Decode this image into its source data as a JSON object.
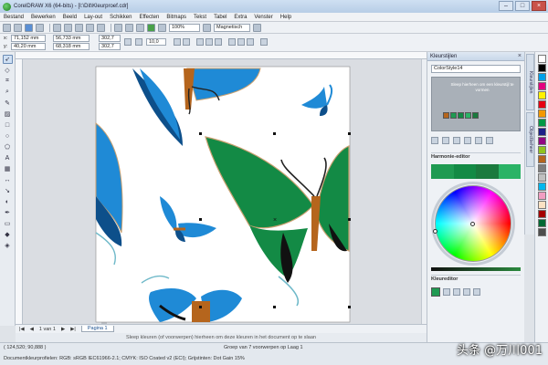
{
  "window": {
    "title": "CorelDRAW X6 (64-bits) - [I:\\Dit\\Kleurproef.cdr]"
  },
  "menu": [
    "Bestand",
    "Bewerken",
    "Beeld",
    "Lay-out",
    "Schikken",
    "Effecten",
    "Bitmaps",
    "Tekst",
    "Tabel",
    "Extra",
    "Venster",
    "Help"
  ],
  "toolbar": {
    "zoom": "100%",
    "snap": "Magnetisch"
  },
  "properties": {
    "x": "71,152 mm",
    "y": "40,20 mm",
    "width": "56,733 mm",
    "height": "68,318 mm",
    "scale_w": "302,7",
    "scale_h": "302,7",
    "angle": "10,0"
  },
  "page_nav": {
    "counter": "1 van 1",
    "tab": "Pagina 1"
  },
  "hint": "Sleep kleuren (of voorwerpen) hierheen om deze kleuren in het document op te slaan",
  "status": {
    "coords": "( 124,520; 90,888 )",
    "selection": "Groep van 7 voorwerpen op Laag 1",
    "profiles": "Documentkleurprofielen: RGB: sRGB IEC61966-2.1; CMYK: ISO Coated v2 (ECI); Grijstinten: Dot Gain 15%"
  },
  "docker": {
    "title": "Kleurstijlen",
    "style_name": "ColorStyle14",
    "info_text": "Sleep hierheen om een kleurstijl te vormen",
    "harmony_title": "Harmonie-editor",
    "color_editor_title": "Kleureditor"
  },
  "docker_tabs": [
    "Kleurstijlen",
    "Objectbeheer"
  ],
  "watermark": "头条 @万川001",
  "colors": {
    "butterfly_blue": "#1f8ad6",
    "butterfly_green": "#138a45",
    "body_brown": "#b5651d",
    "harmony_green": "#1f9a52"
  },
  "icons": {
    "tools": [
      "pick-tool-icon",
      "shape-tool-icon",
      "crop-tool-icon",
      "zoom-tool-icon",
      "freehand-tool-icon",
      "smart-fill-icon",
      "rectangle-tool-icon",
      "ellipse-tool-icon",
      "polygon-tool-icon",
      "text-tool-icon",
      "table-tool-icon",
      "dimension-tool-icon",
      "connector-tool-icon",
      "blend-tool-icon",
      "eyedropper-tool-icon",
      "outline-tool-icon",
      "fill-tool-icon",
      "interactive-fill-icon"
    ]
  }
}
